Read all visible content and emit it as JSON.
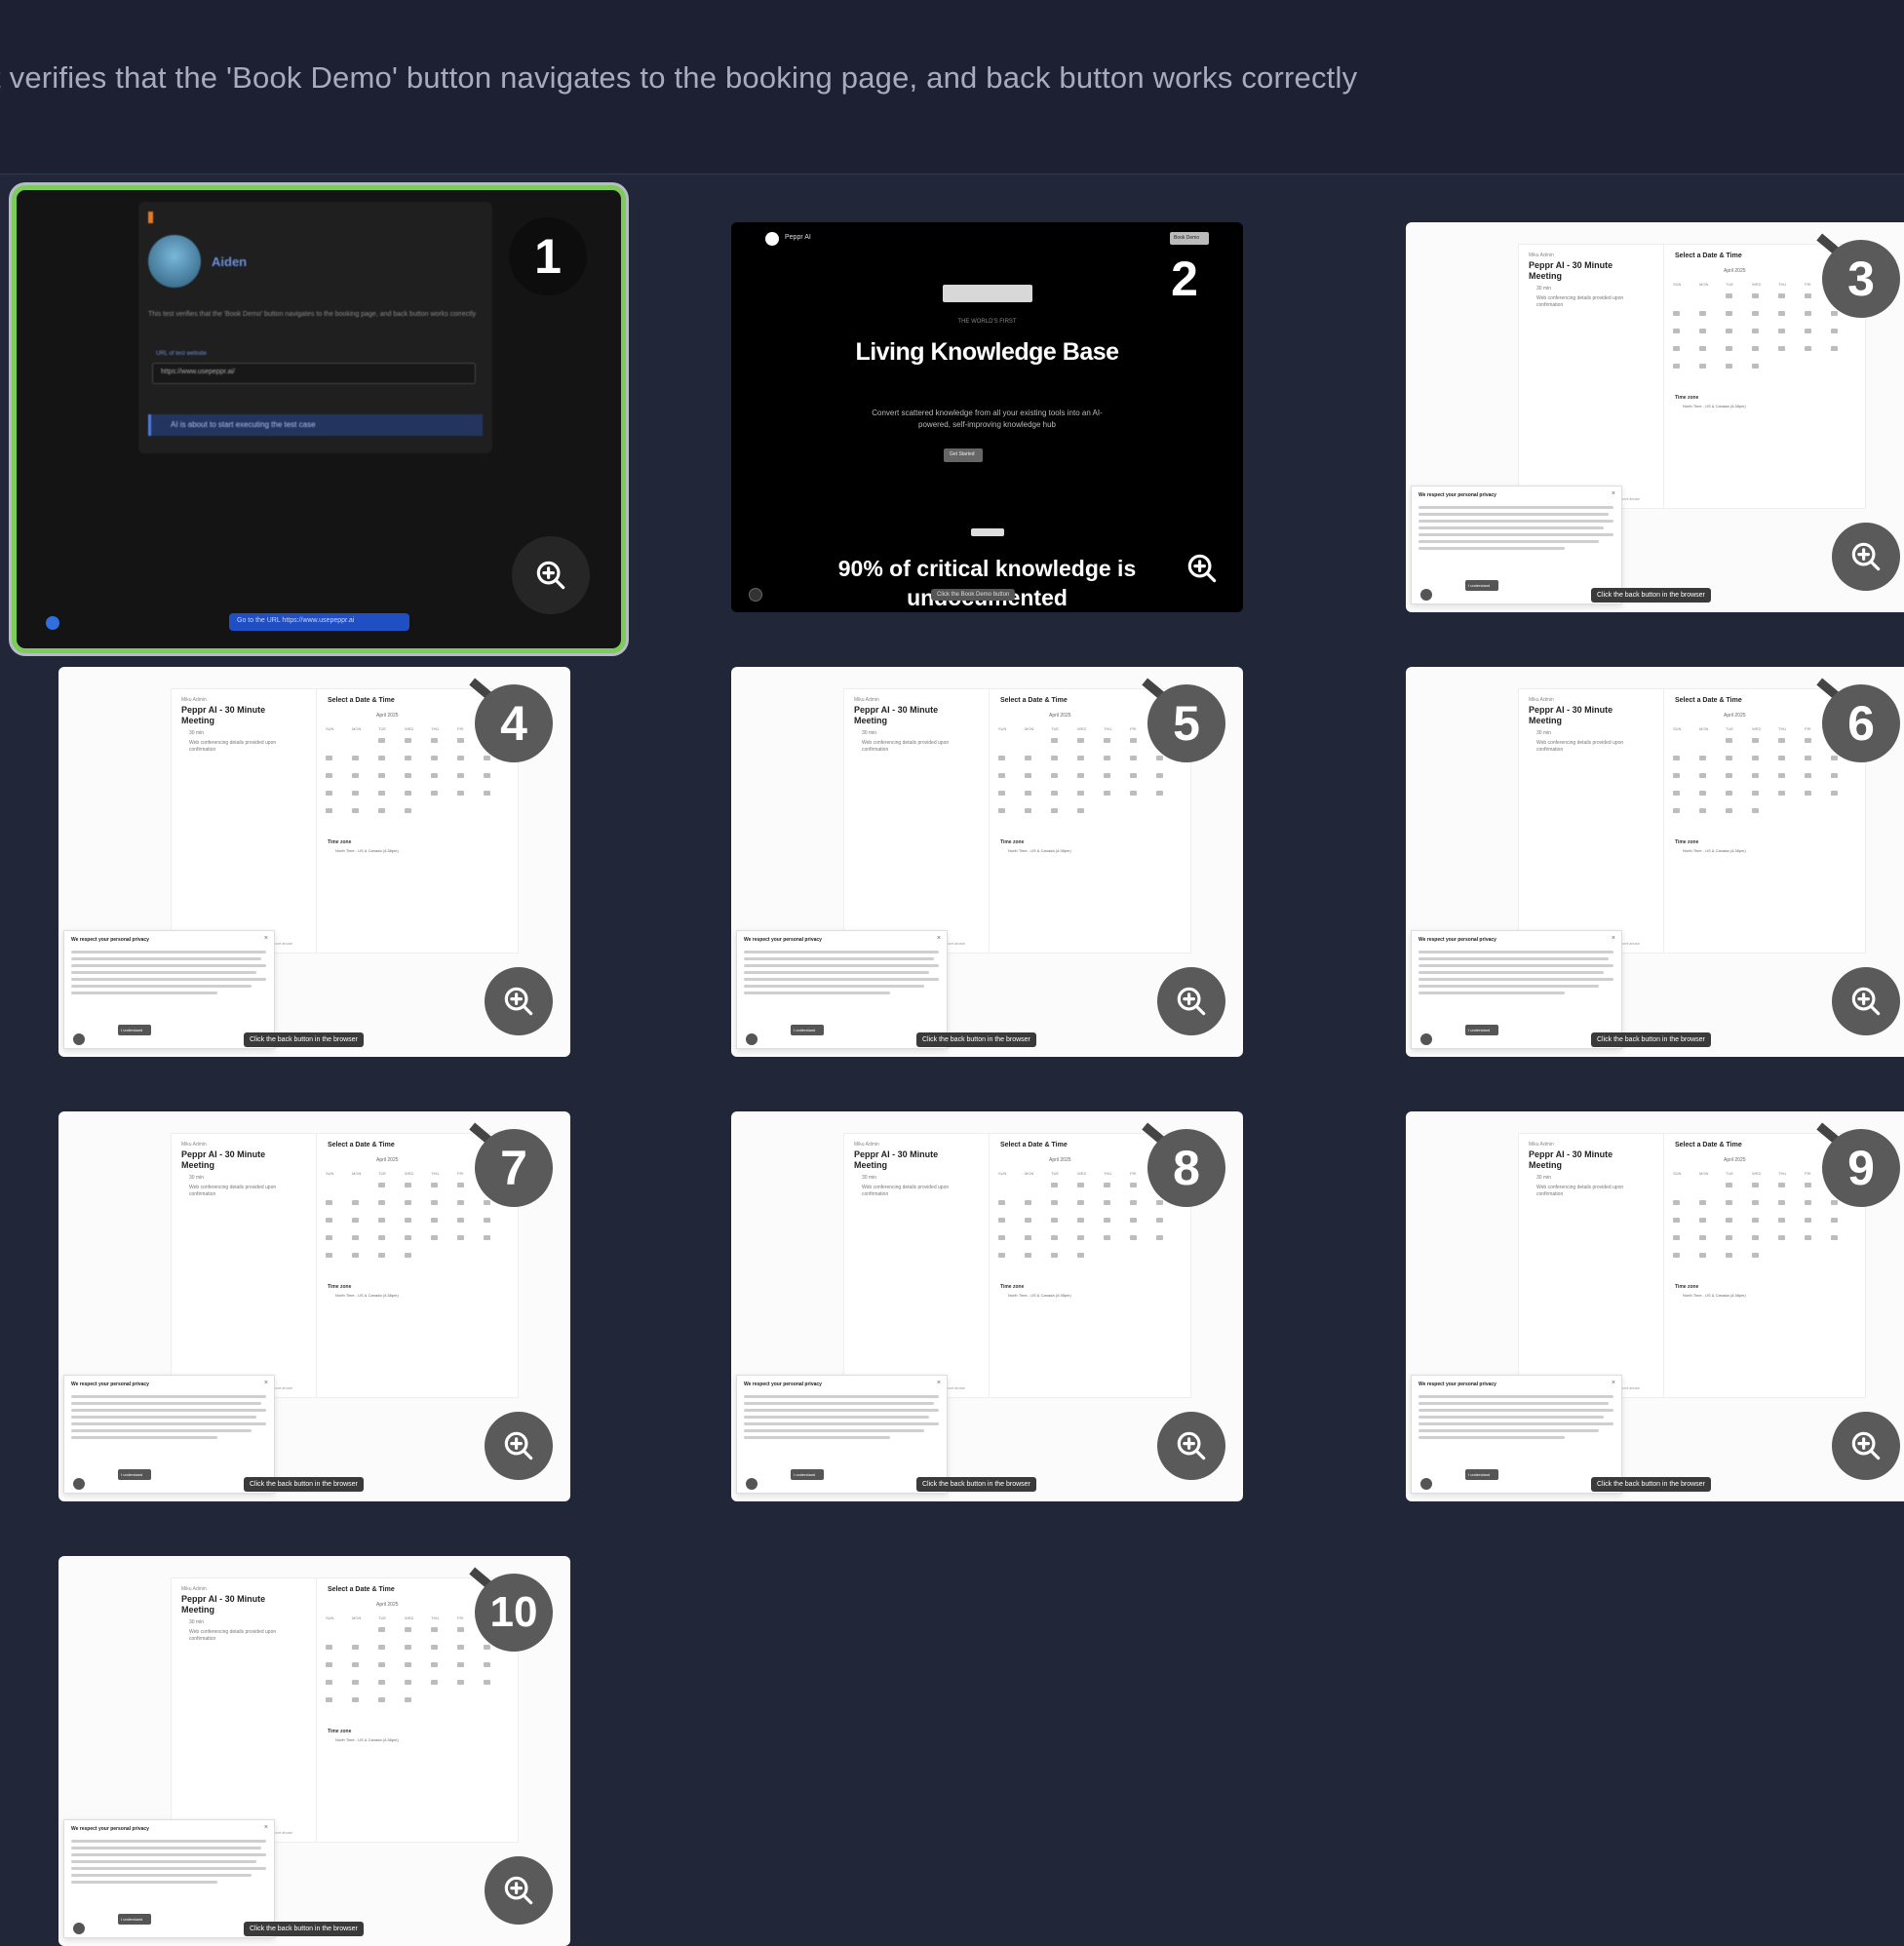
{
  "header": {
    "description": "t verifies that the 'Book Demo' button navigates to the booking page, and back button works correctly"
  },
  "step1": {
    "number": "1",
    "user_name": "Aiden",
    "body_text": "This test verifies that the 'Book Demo' button navigates to the booking page, and back button works correctly",
    "field_label": "URL of test website",
    "field_value": "https://www.usepeppr.ai/",
    "status_text": "AI is about to start executing the test case",
    "caption": "Go to the URL https://www.usepeppr.ai"
  },
  "step2": {
    "number": "2",
    "brand": "Peppr AI",
    "nav_button": "Book Demo",
    "eyebrow": "THE WORLD'S FIRST",
    "headline": "Living Knowledge Base",
    "subtext": "Convert scattered knowledge from all your existing tools into an AI-powered, self-improving knowledge hub",
    "cta": "Get Started",
    "stat": "90% of critical knowledge is undocumented",
    "caption": "Click the Book Demo button"
  },
  "booking": {
    "org": "Miku Admin",
    "title": "Peppr AI - 30 Minute Meeting",
    "duration": "30 min",
    "details": "Web conferencing details provided upon confirmation",
    "picker_title": "Select a Date & Time",
    "month": "April 2025",
    "weekdays": [
      "SUN",
      "MON",
      "TUE",
      "WED",
      "THU",
      "FRI",
      "SAT"
    ],
    "timezone_label": "Time zone",
    "timezone_value": "North Time - US & Canada (4:38pm)",
    "cookie_title": "We respect your personal privacy",
    "cookie_btn": "I understand",
    "cookie_settings": "Cookie settings",
    "report": "Report abuse",
    "caption": "Click the back button in the browser"
  },
  "steps": [
    {
      "number": "3"
    },
    {
      "number": "4"
    },
    {
      "number": "5"
    },
    {
      "number": "6"
    },
    {
      "number": "7"
    },
    {
      "number": "8"
    },
    {
      "number": "9"
    },
    {
      "number": "10"
    }
  ]
}
